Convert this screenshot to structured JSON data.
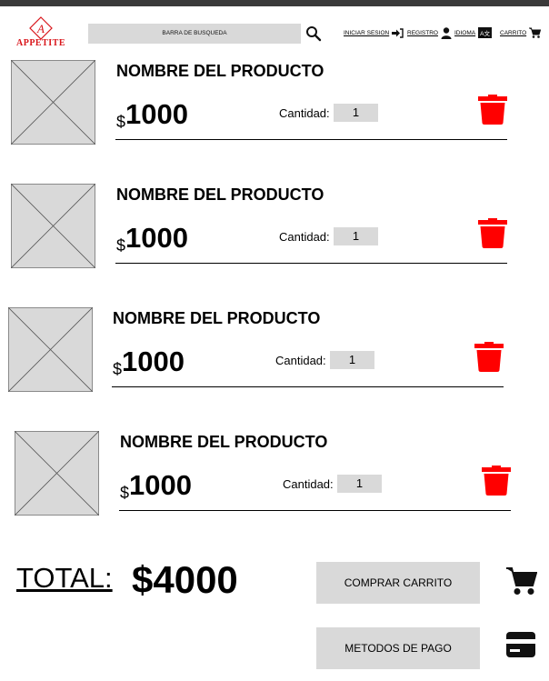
{
  "header": {
    "brand_letter": "A",
    "brand_name": "APPETITE",
    "search_placeholder": "BARRA DE BUSQUEDA",
    "login": "INICIAR SESION",
    "register": "REGISTRO",
    "language": "IDIOMA",
    "language_badge": "A文",
    "cart": "CARRITO"
  },
  "items": [
    {
      "name": "NOMBRE DEL PRODUCTO",
      "currency": "$",
      "price": "1000",
      "qty_label": "Cantidad:",
      "qty": "1"
    },
    {
      "name": "NOMBRE DEL PRODUCTO",
      "currency": "$",
      "price": "1000",
      "qty_label": "Cantidad:",
      "qty": "1"
    },
    {
      "name": "NOMBRE DEL PRODUCTO",
      "currency": "$",
      "price": "1000",
      "qty_label": "Cantidad:",
      "qty": "1"
    },
    {
      "name": "NOMBRE DEL PRODUCTO",
      "currency": "$",
      "price": "1000",
      "qty_label": "Cantidad:",
      "qty": "1"
    }
  ],
  "summary": {
    "total_label": "TOTAL:",
    "total_value": "$4000",
    "buy_button": "COMPRAR CARRITO",
    "payment_button": "METODOS DE PAGO"
  },
  "colors": {
    "accent_red": "#ff0000",
    "placeholder_gray": "#d9d9d9",
    "brand_red": "#d9161b"
  }
}
